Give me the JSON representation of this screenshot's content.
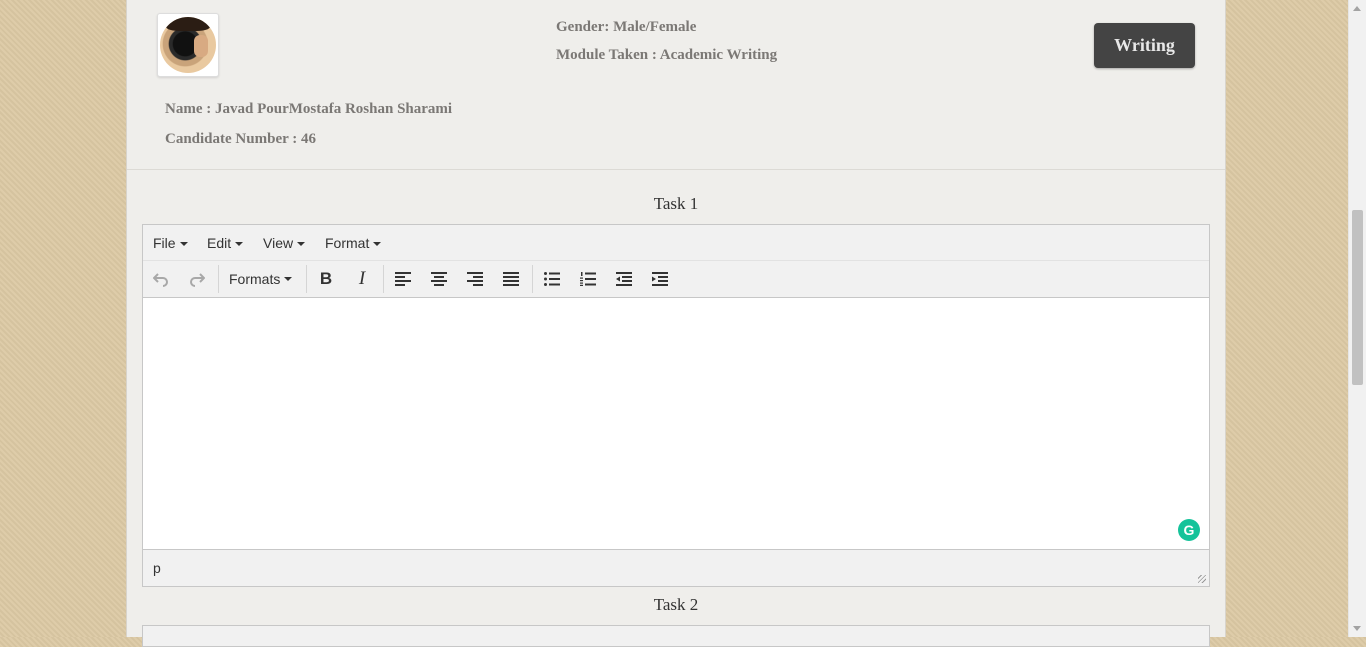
{
  "profile": {
    "name_text": "Name : Javad PourMostafa Roshan Sharami",
    "candidate_text": "Candidate Number : 46",
    "gender_text": "Gender: Male/Female",
    "module_text": "Module Taken : Academic Writing",
    "avatar_icon": "user-avatar-photo"
  },
  "header": {
    "writing_button": "Writing"
  },
  "task1": {
    "title": "Task 1",
    "menu": [
      "File",
      "Edit",
      "View",
      "Format"
    ],
    "toolbar": {
      "formats_label": "Formats",
      "icons": [
        "undo-icon",
        "redo-icon",
        "bold-icon",
        "italic-icon",
        "align-left-icon",
        "align-center-icon",
        "align-right-icon",
        "align-justify-icon",
        "bullet-list-icon",
        "numbered-list-icon",
        "outdent-icon",
        "indent-icon"
      ]
    },
    "status_path": "p"
  },
  "task2": {
    "title": "Task 2"
  },
  "colors": {
    "page_bg": "#dcc9a4",
    "panel_bg": "#efeeeb",
    "button_bg": "#444444",
    "grammarly": "#15c39a"
  }
}
